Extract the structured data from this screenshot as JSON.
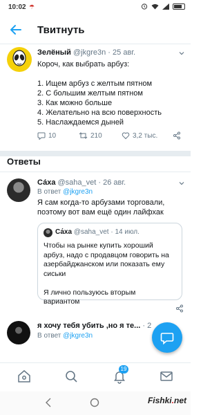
{
  "status": {
    "time": "10:02",
    "notification_icon": "umbrella-icon"
  },
  "header": {
    "title": "Твитнуть"
  },
  "tweet": {
    "author": "Зелёный",
    "handle": "@jkgre3n",
    "separator": "·",
    "date": "25 авг.",
    "lines": [
      "Короч, как выбрать арбуз:",
      "",
      "1. Ищем арбуз с желтым пятном",
      "2. С большим желтым пятном",
      "3. Как можно больше",
      "4. Желательно на всю поверхность",
      "5. Наслаждаемся дыней"
    ],
    "replies": "10",
    "retweets": "210",
    "likes": "3,2 тыс."
  },
  "replies_section": {
    "title": "Ответы"
  },
  "reply1": {
    "author": "Са́ха",
    "handle": "@saha_vet",
    "separator": "·",
    "date": "26 авг.",
    "in_reply_prefix": "В ответ",
    "in_reply_handle": "@jkgre3n",
    "text_lines": [
      "Я сам когда-то арбузами торговали,",
      "поэтому вот вам ещё один лайфхак"
    ],
    "quote": {
      "author": "Са́ха",
      "handle": "@saha_vet",
      "separator": "·",
      "date": "14 июл.",
      "lines": [
        "Чтобы на рынке купить хороший",
        "арбуз, надо с продавцом говорить на",
        "азербайджанском или показать ему",
        "сиськи",
        "",
        "Я лично пользуюсь вторым",
        "вариантом"
      ]
    }
  },
  "reply2": {
    "author": "я хочу тебя убить ,но я те...",
    "separator": "·",
    "date": "2",
    "in_reply_prefix": "В ответ",
    "in_reply_handle": "@jkgre3n"
  },
  "tabbar": {
    "notifications_count": "19"
  },
  "watermark": {
    "text": "Fishki",
    "dot": ".",
    "suffix": "net"
  },
  "colors": {
    "accent": "#1da1f2",
    "alien_avatar": "#f5d10a"
  }
}
